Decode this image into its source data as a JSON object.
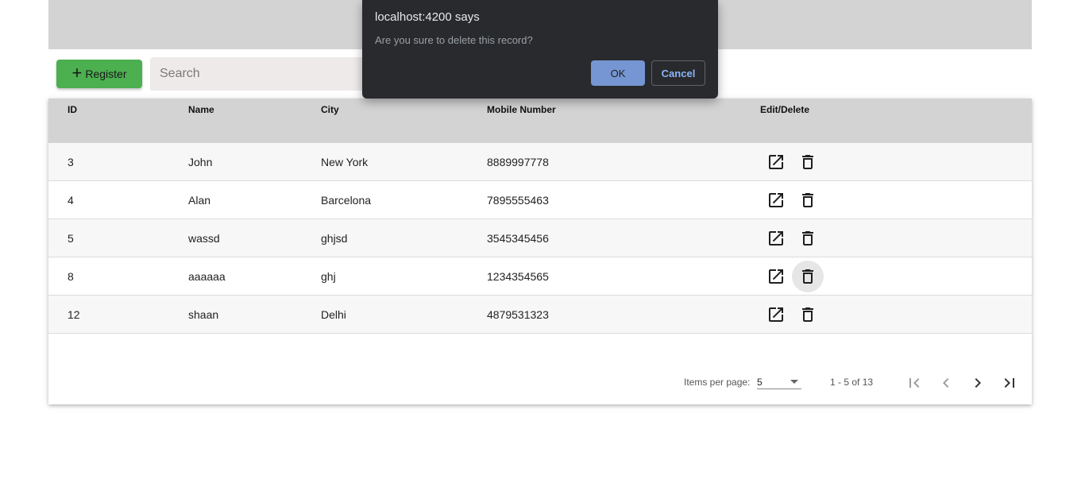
{
  "toolbar": {
    "register_label": "Register",
    "register_icon": "plus-icon",
    "search_placeholder": "Search"
  },
  "table": {
    "columns": [
      "ID",
      "Name",
      "City",
      "Mobile Number",
      "Edit/Delete"
    ],
    "rows": [
      {
        "id": "3",
        "name": "John",
        "city": "New York",
        "mobile": "8889997778"
      },
      {
        "id": "4",
        "name": "Alan",
        "city": "Barcelona",
        "mobile": "7895555463"
      },
      {
        "id": "5",
        "name": "wassd",
        "city": "ghjsd",
        "mobile": "3545345456"
      },
      {
        "id": "8",
        "name": "aaaaaa",
        "city": "ghj",
        "mobile": "1234354565"
      },
      {
        "id": "12",
        "name": "shaan",
        "city": "Delhi",
        "mobile": "4879531323"
      }
    ],
    "row_actions": [
      "open-in-new-icon",
      "delete-icon"
    ]
  },
  "paginator": {
    "items_per_page_label": "Items per page:",
    "page_size": "5",
    "range_label": "1 - 5 of 13",
    "buttons": [
      "first-page-icon",
      "chevron-left-icon",
      "chevron-right-icon",
      "last-page-icon"
    ]
  },
  "dialog": {
    "title": "localhost:4200 says",
    "message": "Are you sure to delete this record?",
    "ok_label": "OK",
    "cancel_label": "Cancel"
  },
  "colors": {
    "header_band": "#d3d3d3",
    "register_green": "#4caf50",
    "dialog_bg": "#292a2d",
    "ok_blue": "#7596d2",
    "cancel_text": "#8ab4f8"
  }
}
